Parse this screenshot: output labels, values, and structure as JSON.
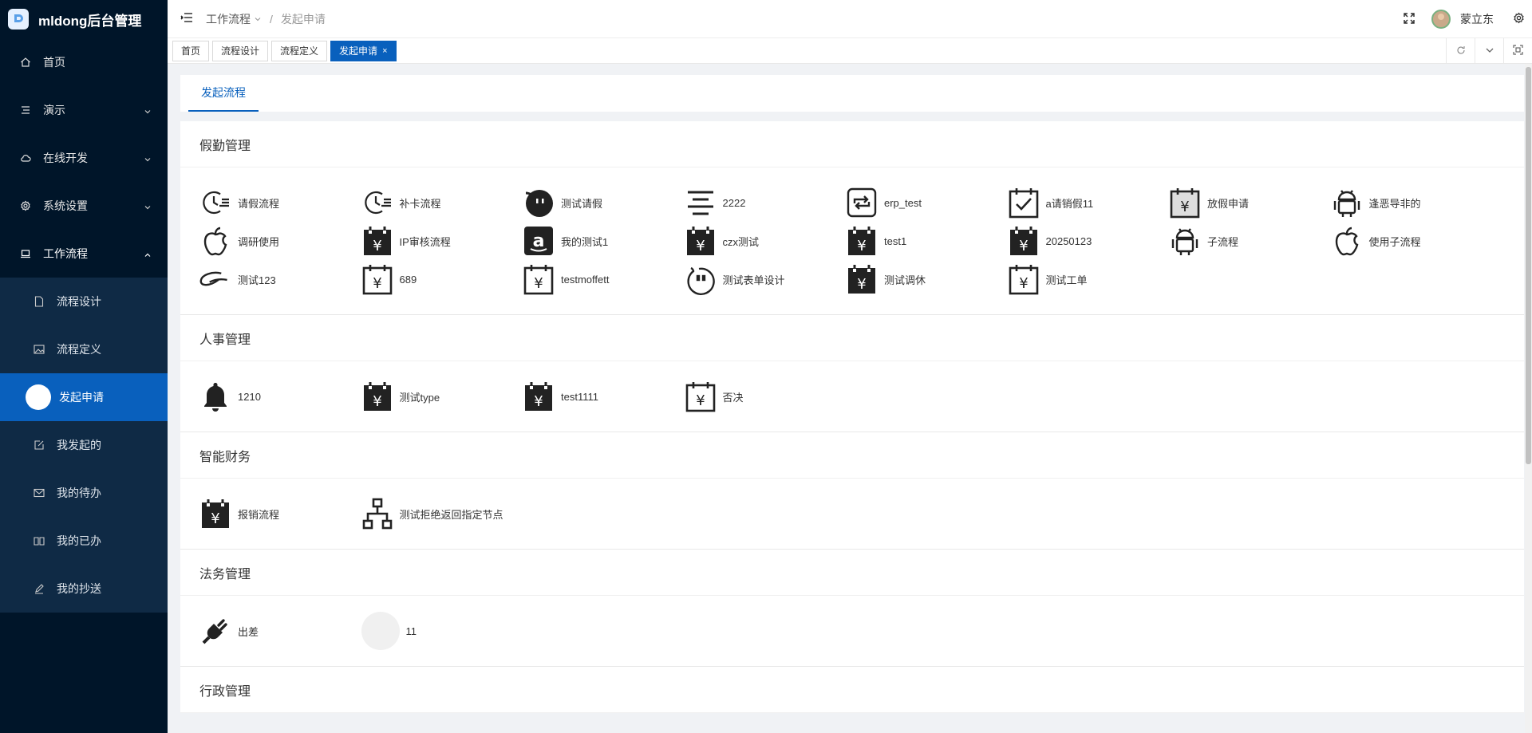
{
  "app": {
    "title": "mldong后台管理"
  },
  "sidebar": {
    "items": [
      {
        "label": "首页",
        "icon": "home-icon"
      },
      {
        "label": "演示",
        "icon": "list-icon"
      },
      {
        "label": "在线开发",
        "icon": "cloud-icon"
      },
      {
        "label": "系统设置",
        "icon": "gear-icon"
      },
      {
        "label": "工作流程",
        "icon": "laptop-icon"
      }
    ],
    "sub_items": [
      {
        "label": "流程设计",
        "icon": "file-icon"
      },
      {
        "label": "流程定义",
        "icon": "image-icon"
      },
      {
        "label": "发起申请",
        "icon": "circle-icon"
      },
      {
        "label": "我发起的",
        "icon": "edit-icon"
      },
      {
        "label": "我的待办",
        "icon": "mail-icon"
      },
      {
        "label": "我的已办",
        "icon": "book-icon"
      },
      {
        "label": "我的抄送",
        "icon": "pen-icon"
      }
    ]
  },
  "header": {
    "breadcrumb": [
      "工作流程",
      "发起申请"
    ],
    "separator": "/",
    "user": "蒙立东"
  },
  "tabs": [
    {
      "label": "首页"
    },
    {
      "label": "流程设计"
    },
    {
      "label": "流程定义"
    },
    {
      "label": "发起申请",
      "close": "×"
    }
  ],
  "content": {
    "tab_label": "发起流程",
    "sections": [
      {
        "title": "假勤管理",
        "items": [
          {
            "label": "请假流程",
            "icon": "clock-list-icon"
          },
          {
            "label": "补卡流程",
            "icon": "clock-list-icon"
          },
          {
            "label": "测试请假",
            "icon": "emoji-face-icon"
          },
          {
            "label": "2222",
            "icon": "align-lines-icon"
          },
          {
            "label": "erp_test",
            "icon": "retweet-icon"
          },
          {
            "label": "a请销假11",
            "icon": "calendar-check-icon"
          },
          {
            "label": "放假申请",
            "icon": "money-calendar-icon"
          },
          {
            "label": "逢恶导非的",
            "icon": "android-icon"
          },
          {
            "label": "调研使用",
            "icon": "apple-icon"
          },
          {
            "label": "IP审核流程",
            "icon": "money-calendar-filled-icon"
          },
          {
            "label": "我的测试1",
            "icon": "amazon-icon"
          },
          {
            "label": "czx测试",
            "icon": "money-calendar-filled-icon"
          },
          {
            "label": "test1",
            "icon": "money-calendar-filled-icon"
          },
          {
            "label": "20250123",
            "icon": "money-calendar-filled-icon"
          },
          {
            "label": "子流程",
            "icon": "android-icon"
          },
          {
            "label": "使用子流程",
            "icon": "apple-icon"
          },
          {
            "label": "测试123",
            "icon": "alibaba-icon"
          },
          {
            "label": "689",
            "icon": "money-calendar-icon"
          },
          {
            "label": "testmoffett",
            "icon": "money-calendar-icon"
          },
          {
            "label": "测试表单设计",
            "icon": "smile-outline-icon"
          },
          {
            "label": "测试调休",
            "icon": "money-calendar-filled-icon"
          },
          {
            "label": "测试工单",
            "icon": "money-calendar-icon"
          }
        ]
      },
      {
        "title": "人事管理",
        "items": [
          {
            "label": "1210",
            "icon": "bell-icon"
          },
          {
            "label": "测试type",
            "icon": "money-calendar-filled-icon"
          },
          {
            "label": "test1111",
            "icon": "money-calendar-filled-icon"
          },
          {
            "label": "否决",
            "icon": "money-calendar-icon"
          }
        ]
      },
      {
        "title": "智能财务",
        "items": [
          {
            "label": "报销流程",
            "icon": "money-calendar-filled-icon"
          },
          {
            "label": "测试拒绝返回指定节点",
            "icon": "hierarchy-icon"
          }
        ]
      },
      {
        "title": "法务管理",
        "items": [
          {
            "label": "出差",
            "icon": "plug-icon"
          },
          {
            "label": "11",
            "icon": "placeholder-circle"
          }
        ]
      },
      {
        "title": "行政管理",
        "items": []
      }
    ]
  },
  "colors": {
    "sidebar_bg": "#001529",
    "accent": "#0960bd",
    "submenu_bg": "#0f2a45"
  }
}
